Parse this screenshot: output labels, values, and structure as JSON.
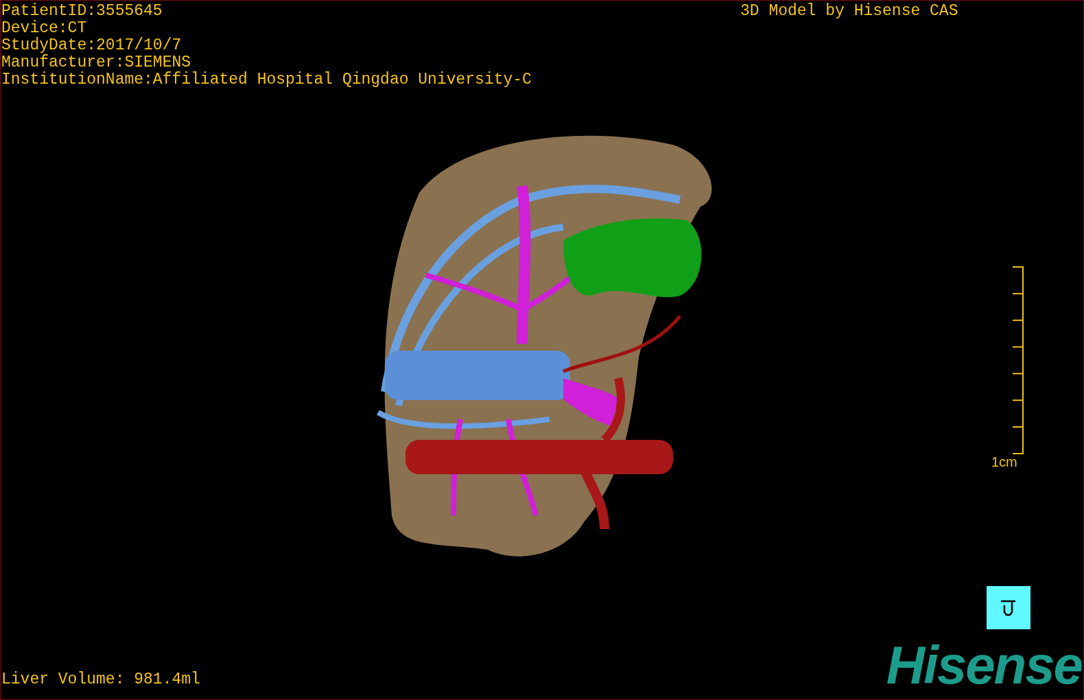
{
  "info_lines": [
    "PatientID:3555645",
    "Device:CT",
    "StudyDate:2017/10/7",
    "Manufacturer:SIEMENS",
    "InstitutionName:Affiliated Hospital Qingdao University-C"
  ],
  "header": "3D Model by Hisense CAS",
  "scale_bar": {
    "label": "1cm"
  },
  "logo": "Hisense",
  "liver_volume": "Liver Volume: 981.4ml"
}
